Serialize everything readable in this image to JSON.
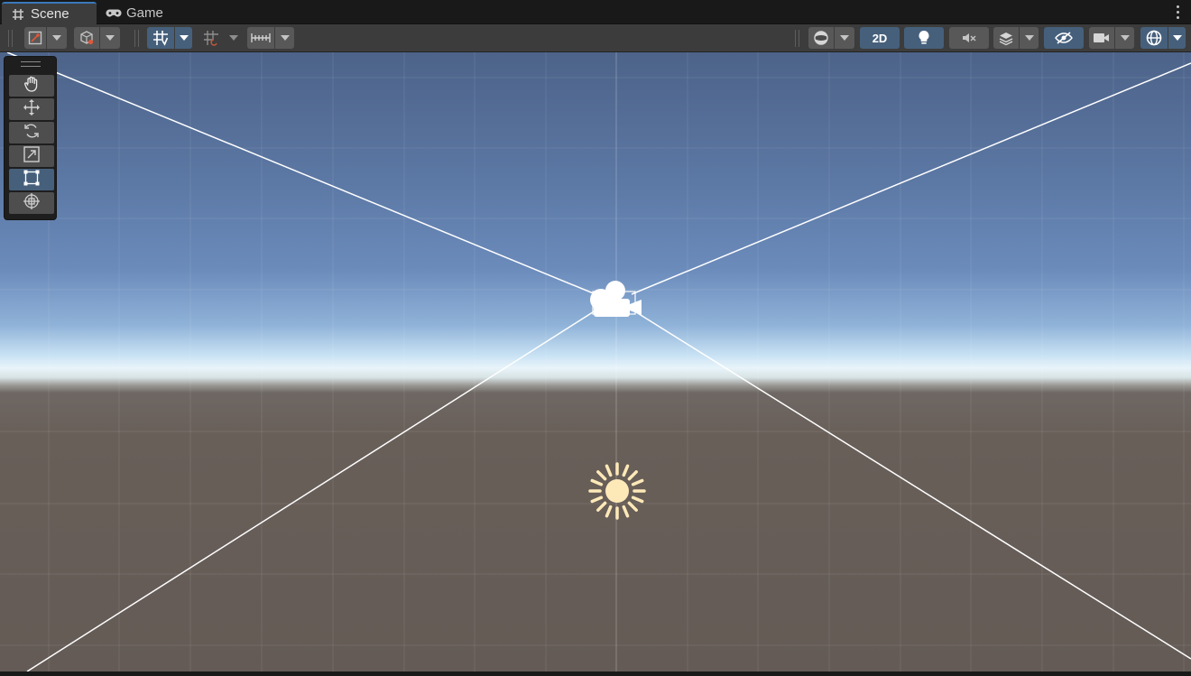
{
  "tabs": [
    {
      "label": "Scene",
      "icon": "grid-hash-icon",
      "active": true
    },
    {
      "label": "Game",
      "icon": "gamepad-icon",
      "active": false
    }
  ],
  "toolbar": {
    "view_2d_label": "2D",
    "left_buttons": [
      {
        "name": "gizmo-tool-handle-button",
        "icon": "tool-handle-icon"
      },
      {
        "name": "draw-mode-button",
        "icon": "shaded-cube-icon"
      },
      {
        "name": "grid-snapping-button",
        "icon": "grid-snap-icon",
        "active": true
      },
      {
        "name": "incremental-snap-button",
        "icon": "increment-snap-icon"
      },
      {
        "name": "ruler-snap-button",
        "icon": "ruler-icon"
      }
    ],
    "right_buttons": [
      {
        "name": "shading-mode-button",
        "icon": "sphere-icon"
      },
      {
        "name": "2d-view-toggle",
        "active": true
      },
      {
        "name": "lighting-toggle",
        "icon": "lightbulb-icon",
        "active": true
      },
      {
        "name": "audio-toggle",
        "icon": "audio-mute-icon"
      },
      {
        "name": "effects-button",
        "icon": "layers-icon"
      },
      {
        "name": "scene-visibility-toggle",
        "icon": "eye-slash-icon",
        "active": true
      },
      {
        "name": "camera-settings-button",
        "icon": "video-camera-icon"
      },
      {
        "name": "gizmos-button",
        "icon": "gizmo-globe-icon",
        "active": true
      }
    ]
  },
  "tools": [
    {
      "name": "hand-tool",
      "icon": "hand-icon",
      "active": false
    },
    {
      "name": "move-tool",
      "icon": "move-arrows-icon",
      "active": false
    },
    {
      "name": "rotate-tool",
      "icon": "rotate-icon",
      "active": false
    },
    {
      "name": "scale-tool",
      "icon": "scale-icon",
      "active": false
    },
    {
      "name": "rect-tool",
      "icon": "rect-transform-icon",
      "active": true
    },
    {
      "name": "transform-tool",
      "icon": "transform-icon",
      "active": false
    }
  ],
  "scene": {
    "gizmos": [
      "camera-gizmo-icon",
      "directional-light-icon"
    ]
  },
  "colors": {
    "accent": "#3a79bb",
    "active_button": "#46607c",
    "sky_top": "#4d6389",
    "horizon": "#e9f4fa",
    "ground": "#645b56",
    "sun": "#fde9b8"
  }
}
